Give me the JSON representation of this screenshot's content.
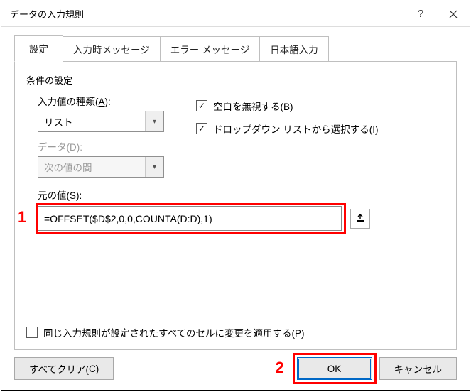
{
  "title": "データの入力規則",
  "tabs": {
    "settings": "設定",
    "input_msg": "入力時メッセージ",
    "error_msg": "エラー メッセージ",
    "ime": "日本語入力"
  },
  "group": {
    "title": "条件の設定"
  },
  "allow": {
    "label_pre": "入力値の種類(",
    "label_u": "A",
    "label_post": "):",
    "value": "リスト"
  },
  "data_field": {
    "label_pre": "データ(",
    "label_u": "D",
    "label_post": "):",
    "value": "次の値の間"
  },
  "checks": {
    "ignore_blank_pre": "空白を無視する(",
    "ignore_blank_u": "B",
    "ignore_blank_post": ")",
    "dropdown_pre": "ドロップダウン リストから選択する(",
    "dropdown_u": "I",
    "dropdown_post": ")"
  },
  "source": {
    "label_pre": "元の値(",
    "label_u": "S",
    "label_post": "):",
    "value": "=OFFSET($D$2,0,0,COUNTA(D:D),1)"
  },
  "apply": {
    "label_pre": "同じ入力規則が設定されたすべてのセルに変更を適用する(",
    "label_u": "P",
    "label_post": ")"
  },
  "buttons": {
    "clear_pre": "すべてクリア(",
    "clear_u": "C",
    "clear_post": ")",
    "ok": "OK",
    "cancel": "キャンセル"
  },
  "annotations": {
    "one": "1",
    "two": "2"
  }
}
